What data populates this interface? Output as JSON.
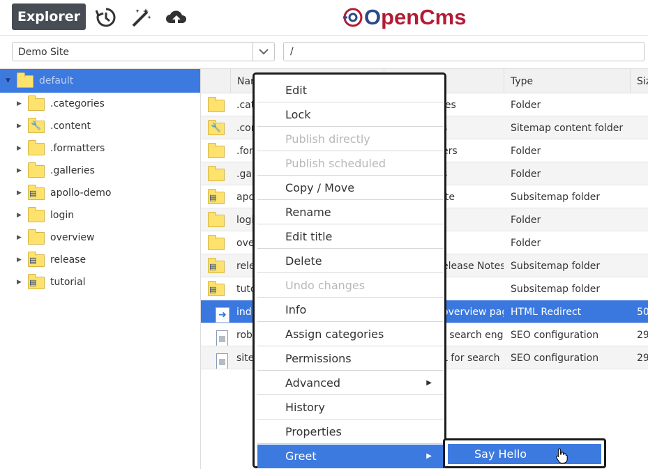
{
  "app": {
    "title": "Explorer",
    "logo_text_o": "O",
    "logo_text": "penCms"
  },
  "topbar": {
    "icons": [
      "history-icon",
      "magic-wand-icon",
      "upload-cloud-icon"
    ]
  },
  "site_selector": {
    "value": "Demo Site"
  },
  "path": {
    "value": "/"
  },
  "tree": {
    "root": {
      "label": "default"
    },
    "items": [
      {
        "label": ".categories",
        "icon": "folder"
      },
      {
        "label": ".content",
        "icon": "content-folder"
      },
      {
        "label": ".formatters",
        "icon": "folder"
      },
      {
        "label": ".galleries",
        "icon": "folder"
      },
      {
        "label": "apollo-demo",
        "icon": "subsitemap-folder"
      },
      {
        "label": "login",
        "icon": "folder"
      },
      {
        "label": "overview",
        "icon": "folder"
      },
      {
        "label": "release",
        "icon": "subsitemap-folder"
      },
      {
        "label": "tutorial",
        "icon": "subsitemap-folder"
      }
    ]
  },
  "table": {
    "headers": {
      "name": "Nar",
      "type": "Type",
      "size": "Siz"
    },
    "rows": [
      {
        "name": ".cat",
        "title": "ies",
        "type": "Folder",
        "size": "",
        "icon": "folder"
      },
      {
        "name": ".con",
        "title": "s",
        "type": "Sitemap content folder",
        "size": "",
        "icon": "content-folder"
      },
      {
        "name": ".for",
        "title": "ers",
        "type": "Folder",
        "size": "",
        "icon": "folder"
      },
      {
        "name": ".gal",
        "title": "s",
        "type": "Folder",
        "size": "",
        "icon": "folder"
      },
      {
        "name": "apo",
        "title": "ite",
        "type": "Subsitemap folder",
        "size": "",
        "icon": "subsitemap-folder"
      },
      {
        "name": "logi",
        "title": "",
        "type": "Folder",
        "size": "",
        "icon": "folder"
      },
      {
        "name": "ove",
        "title": "",
        "type": "Folder",
        "size": "",
        "icon": "folder"
      },
      {
        "name": "rele",
        "title": "elease Notes",
        "type": "Subsitemap folder",
        "size": "",
        "icon": "subsitemap-folder"
      },
      {
        "name": "tuto",
        "title": "",
        "type": "Subsitemap folder",
        "size": "",
        "icon": "subsitemap-folder"
      },
      {
        "name": "ind",
        "title": "overview pag",
        "type": "HTML Redirect",
        "size": "50",
        "icon": "redirect"
      },
      {
        "name": "rob",
        "title": "r search eng",
        "type": "SEO configuration",
        "size": "29",
        "icon": "document"
      },
      {
        "name": "site",
        "title": "L for search",
        "type": "SEO configuration",
        "size": "29",
        "icon": "document"
      }
    ]
  },
  "context_menu": {
    "items": [
      {
        "label": "Edit",
        "disabled": false
      },
      {
        "label": "Lock",
        "disabled": false
      },
      {
        "label": "Publish directly",
        "disabled": true
      },
      {
        "label": "Publish scheduled",
        "disabled": true
      },
      {
        "label": "Copy / Move",
        "disabled": false
      },
      {
        "label": "Rename",
        "disabled": false
      },
      {
        "label": "Edit title",
        "disabled": false
      },
      {
        "label": "Delete",
        "disabled": false
      },
      {
        "label": "Undo changes",
        "disabled": true
      },
      {
        "label": "Info",
        "disabled": false
      },
      {
        "label": "Assign categories",
        "disabled": false
      },
      {
        "label": "Permissions",
        "disabled": false
      },
      {
        "label": "Advanced",
        "disabled": false,
        "submenu": true
      },
      {
        "label": "History",
        "disabled": false
      },
      {
        "label": "Properties",
        "disabled": false
      },
      {
        "label": "Greet",
        "disabled": false,
        "submenu": true,
        "active": true
      }
    ]
  },
  "submenu": {
    "item": "Say Hello"
  },
  "colors": {
    "accent": "#3d7ae0",
    "brand": "#b31b34",
    "folder": "#fde26d"
  }
}
